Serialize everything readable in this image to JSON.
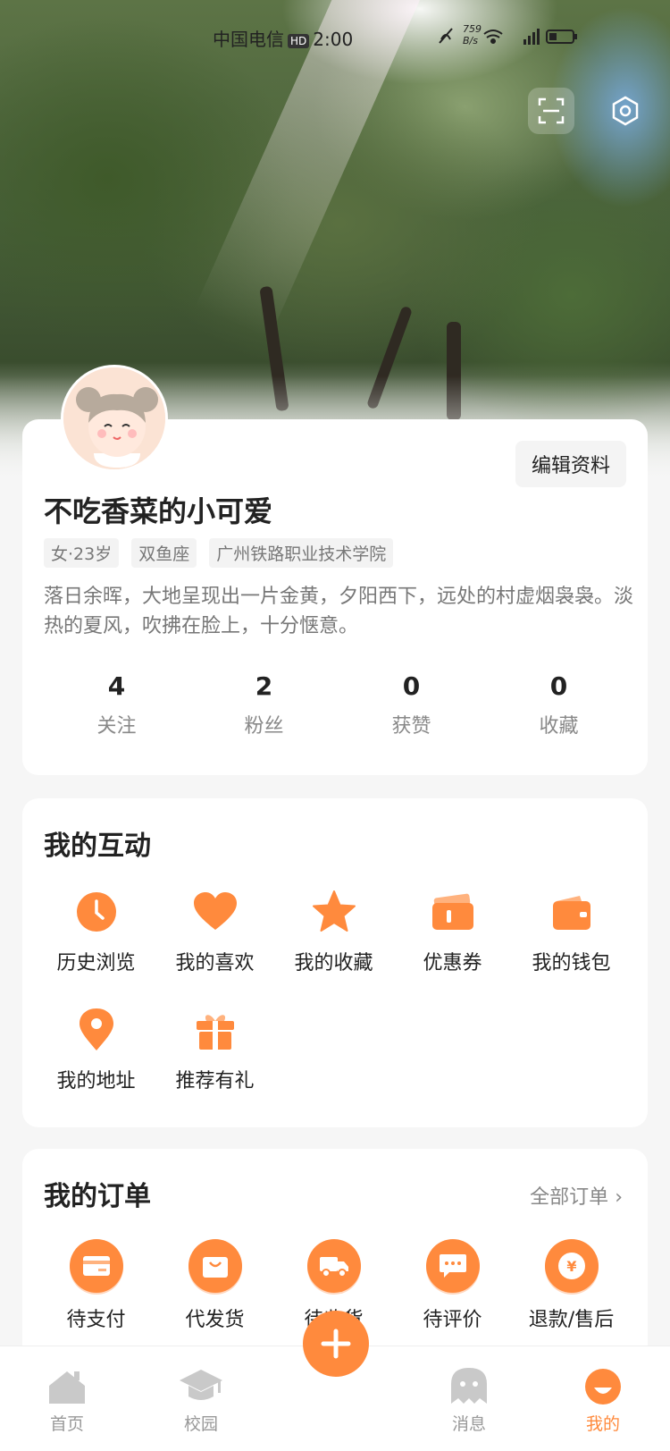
{
  "status_bar": {
    "carrier": "中国电信",
    "hd": "HD",
    "time": "2:00",
    "speed_value": "759",
    "speed_unit": "B/s"
  },
  "header": {
    "scan_icon": "scan-icon",
    "settings_icon": "settings-icon"
  },
  "profile": {
    "edit_label": "编辑资料",
    "name": "不吃香菜的小可爱",
    "tags": [
      "女·23岁",
      "双鱼座",
      "广州铁路职业技术学院"
    ],
    "bio": "落日余晖，大地呈现出一片金黄，夕阳西下，远处的村虚烟袅袅。淡热的夏风，吹拂在脸上，十分惬意。",
    "stats": [
      {
        "num": "4",
        "label": "关注"
      },
      {
        "num": "2",
        "label": "粉丝"
      },
      {
        "num": "0",
        "label": "获赞"
      },
      {
        "num": "0",
        "label": "收藏"
      }
    ]
  },
  "interactions": {
    "title": "我的互动",
    "items": [
      {
        "label": "历史浏览",
        "icon": "clock-icon"
      },
      {
        "label": "我的喜欢",
        "icon": "heart-icon"
      },
      {
        "label": "我的收藏",
        "icon": "star-icon"
      },
      {
        "label": "优惠券",
        "icon": "coupon-icon"
      },
      {
        "label": "我的钱包",
        "icon": "wallet-icon"
      },
      {
        "label": "我的地址",
        "icon": "location-icon"
      },
      {
        "label": "推荐有礼",
        "icon": "gift-icon"
      }
    ]
  },
  "orders": {
    "title": "我的订单",
    "all_label": "全部订单",
    "items": [
      {
        "label": "待支付",
        "icon": "card-icon"
      },
      {
        "label": "代发货",
        "icon": "bag-icon"
      },
      {
        "label": "待收货",
        "icon": "truck-icon"
      },
      {
        "label": "待评价",
        "icon": "chat-icon"
      },
      {
        "label": "退款/售后",
        "icon": "yen-icon"
      }
    ]
  },
  "nav": {
    "items": [
      {
        "label": "首页",
        "icon": "home-icon"
      },
      {
        "label": "校园",
        "icon": "campus-icon"
      },
      {
        "label": "消息",
        "icon": "message-icon"
      },
      {
        "label": "我的",
        "icon": "profile-icon"
      }
    ],
    "active": "我的",
    "accent": "#ff8a3d"
  }
}
